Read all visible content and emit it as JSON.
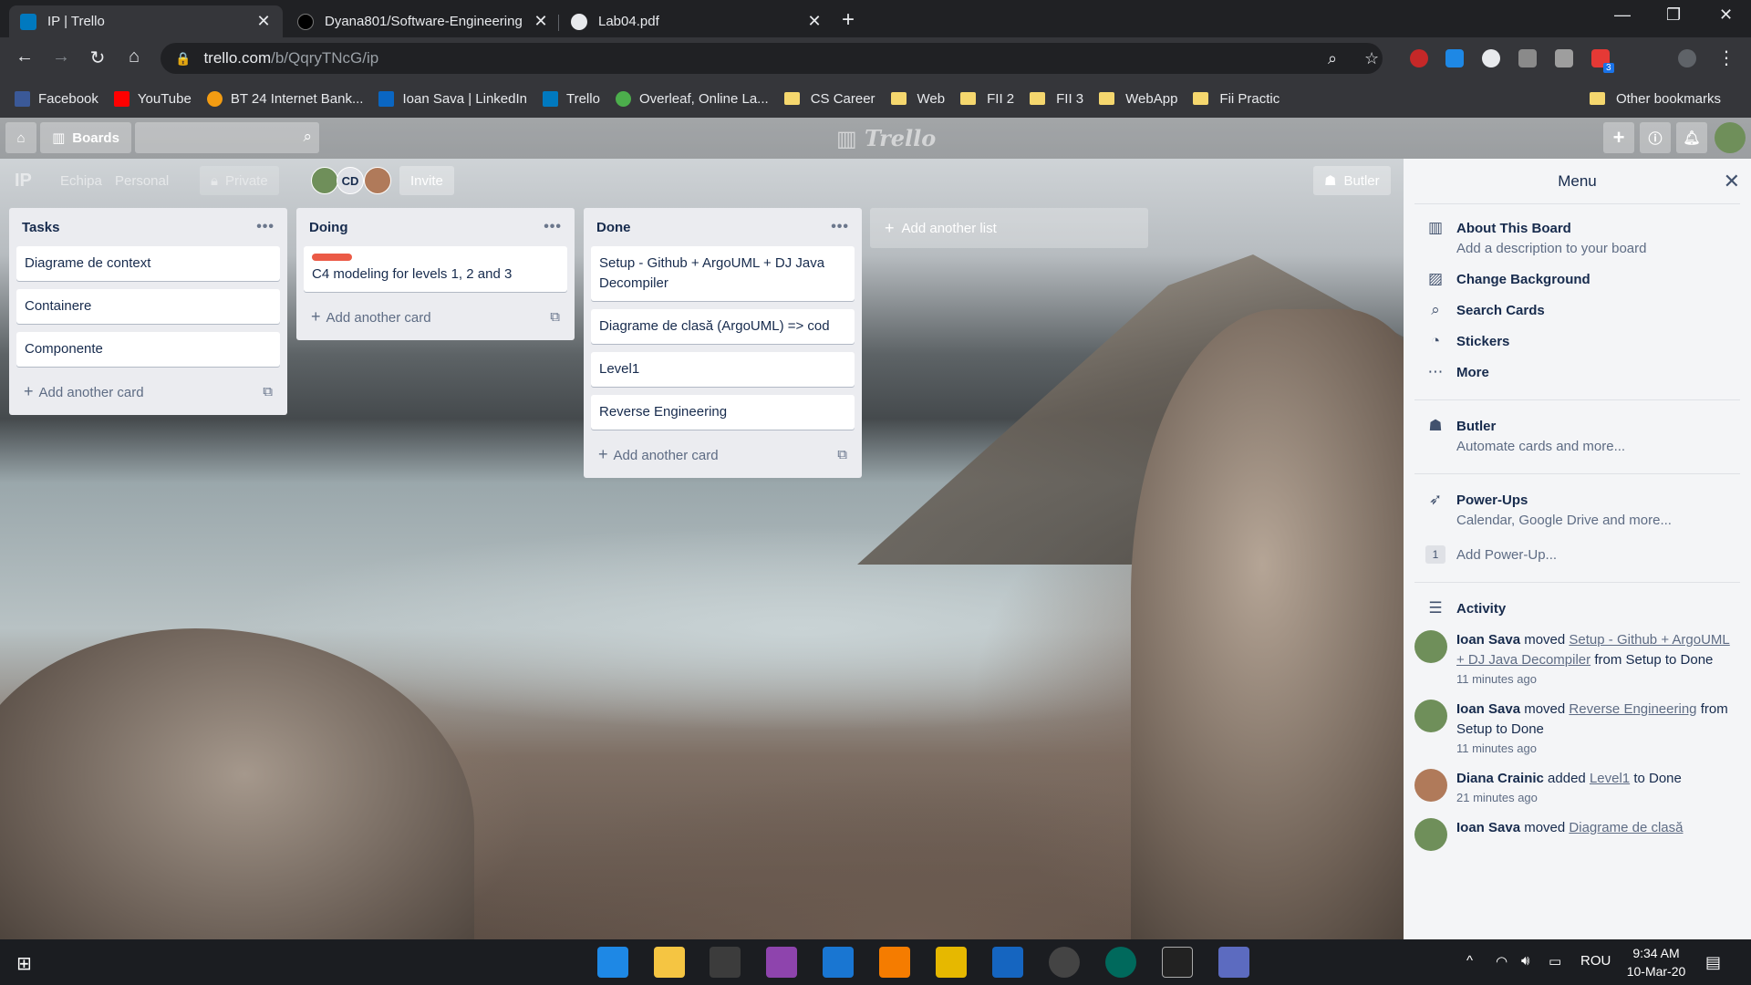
{
  "browser": {
    "tabs": [
      {
        "title": "IP | Trello",
        "active": true
      },
      {
        "title": "Dyana801/Software-Engineering",
        "active": false
      },
      {
        "title": "Lab04.pdf",
        "active": false
      }
    ],
    "url_domain": "trello.com",
    "url_path": "/b/QqryTNcG/ip",
    "bookmarks": [
      {
        "label": "Facebook",
        "color": "#3b5998"
      },
      {
        "label": "YouTube",
        "color": "#ff0000"
      },
      {
        "label": "BT 24 Internet Bank...",
        "color": "#f39c12"
      },
      {
        "label": "Ioan Sava | LinkedIn",
        "color": "#0a66c2"
      },
      {
        "label": "Trello",
        "color": "#0079bf"
      },
      {
        "label": "Overleaf, Online La...",
        "color": "#4cae4c"
      },
      {
        "label": "CS Career",
        "folder": true
      },
      {
        "label": "Web",
        "folder": true
      },
      {
        "label": "FII 2",
        "folder": true
      },
      {
        "label": "FII 3",
        "folder": true
      },
      {
        "label": "WebApp",
        "folder": true
      },
      {
        "label": "Fii Practic",
        "folder": true
      }
    ],
    "other_bookmarks": "Other bookmarks",
    "ext_badge": "3"
  },
  "trello": {
    "boards_label": "Boards",
    "logo": "Trello",
    "board_title": "IP",
    "team": "Echipa",
    "personal": "Personal",
    "visibility": "Private",
    "member_initials": "CD",
    "invite_label": "Invite",
    "butler_label": "Butler",
    "lists": [
      {
        "name": "Tasks",
        "cards": [
          {
            "text": "Diagrame de context"
          },
          {
            "text": "Containere"
          },
          {
            "text": "Componente"
          }
        ],
        "add_label": "Add another card"
      },
      {
        "name": "Doing",
        "cards": [
          {
            "text": "C4 modeling for levels 1, 2 and 3",
            "label_color": "#eb5a46"
          }
        ],
        "add_label": "Add another card"
      },
      {
        "name": "Done",
        "cards": [
          {
            "text": "Setup - Github + ArgoUML + DJ Java Decompiler"
          },
          {
            "text": "Diagrame de clasă (ArgoUML) => cod"
          },
          {
            "text": "Level1"
          },
          {
            "text": "Reverse Engineering"
          }
        ],
        "add_label": "Add another card"
      }
    ],
    "add_list_label": "Add another list"
  },
  "menu": {
    "title": "Menu",
    "items": [
      {
        "title": "About This Board",
        "subtitle": "Add a description to your board"
      },
      {
        "title": "Change Background"
      },
      {
        "title": "Search Cards"
      },
      {
        "title": "Stickers"
      },
      {
        "title": "More"
      }
    ],
    "butler": {
      "title": "Butler",
      "subtitle": "Automate cards and more..."
    },
    "powerups": {
      "title": "Power-Ups",
      "subtitle": "Calendar, Google Drive and more...",
      "count": "1",
      "add": "Add Power-Up..."
    },
    "activity_title": "Activity",
    "activity": [
      {
        "user": "Ioan Sava",
        "verb": "moved",
        "card": "Setup - Github + ArgoUML + DJ Java Decompiler",
        "rest": "from Setup to Done",
        "when": "11 minutes ago"
      },
      {
        "user": "Ioan Sava",
        "verb": "moved",
        "card": "Reverse Engineering",
        "rest": "from Setup to Done",
        "when": "11 minutes ago"
      },
      {
        "user": "Diana Crainic",
        "verb": "added",
        "card": "Level1",
        "rest": "to Done",
        "when": "21 minutes ago"
      },
      {
        "user": "Ioan Sava",
        "verb": "moved",
        "card": "Diagrame de clasă",
        "rest": "",
        "when": ""
      }
    ]
  },
  "taskbar": {
    "time": "9:34 AM",
    "date": "10-Mar-20",
    "lang": "ROU"
  }
}
